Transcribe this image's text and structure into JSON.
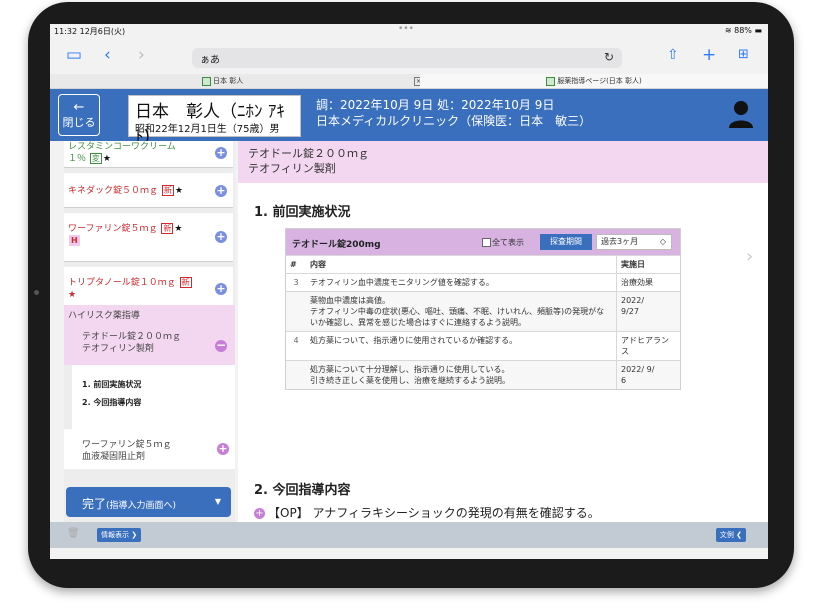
{
  "status_bar": {
    "time": "11:32  12月6日(火)",
    "dots": "•••",
    "battery": "88%"
  },
  "browser": {
    "address": "ぁあ",
    "tabs": [
      {
        "label": "日本 彰人"
      },
      {
        "label": ""
      },
      {
        "label": "服薬指導ページ(日本 彰人)"
      }
    ]
  },
  "header": {
    "back_label": "閉じる",
    "patient_name": "日本　彰人（ﾆﾎﾝ ｱｷﾄ)",
    "patient_sub": "昭和22年12月1日生（75歳）男",
    "dispense_line": "調：2022年10月 9日  処：2022年10月 9日",
    "clinic_line": "日本メディカルクリニック（保険医：日本　敏三）"
  },
  "sidebar": {
    "cards": [
      {
        "name": "レスタミンコーワクリーム",
        "sub": "１％",
        "badge": "変",
        "star": "★"
      },
      {
        "name": "キネダック錠５０ｍｇ",
        "badge": "新",
        "star": "★"
      },
      {
        "name": "ワーファリン錠５ｍｇ",
        "badge": "新",
        "star": "★",
        "extra_badge": "H"
      },
      {
        "name": "トリプタノール錠１０ｍｇ",
        "badge": "新",
        "star": "★"
      }
    ],
    "section_title": "ハイリスク薬指導",
    "active_drug": {
      "name": "テオドール錠２００ｍｇ",
      "category": "テオフィリン製剤"
    },
    "sub_items": [
      "1. 前回実施状況",
      "2. 今回指導内容"
    ],
    "next_drug": {
      "name": "ワーファリン錠５ｍｇ",
      "category": "血液凝固阻止剤"
    },
    "complete_label": "完了",
    "complete_sub": "(指導入力画面へ)"
  },
  "content": {
    "drug_name": "テオドール錠２００ｍｇ",
    "drug_category": "テオフィリン製剤",
    "section1_title": "1. 前回実施状況",
    "table": {
      "drug": "テオドール錠200mg",
      "show_all_label": "全て表示",
      "search_period_label": "探査期間",
      "period_value": "過去3ヶ月",
      "columns": [
        "#",
        "内容",
        "実施日"
      ],
      "rows": [
        {
          "num": "3",
          "content": "テオフィリン血中濃度モニタリング値を確認する。",
          "date": "治療効果"
        },
        {
          "num": "",
          "content": "薬物血中濃度は高値。\nテオフィリン中毒の症状(悪心、嘔吐、頭痛、不眠、けいれん、頻脈等)の発現がないか確認し、異常を感じた場合はすぐに連絡するよう説明。",
          "date": "2022/\n9/27"
        },
        {
          "num": "4",
          "content": "処方薬について、指示通りに使用されているか確認する。",
          "date": "アドヒアランス"
        },
        {
          "num": "",
          "content": "処方薬について十分理解し、指示通りに使用している。\n引き続き正しく薬を使用し、治療を継続するよう説明。",
          "date": "2022/ 9/\n6"
        }
      ]
    },
    "section2_title": "2. 今回指導内容",
    "op_text": "【OP】 アナフィラキシーショックの発現の有無を確認する。"
  },
  "footer": {
    "info_label": "情報表示",
    "example_label": "文例"
  },
  "colors": {
    "header_blue": "#3a6fbe",
    "pink": "#f3d7f0",
    "red_text": "#d0282b"
  }
}
